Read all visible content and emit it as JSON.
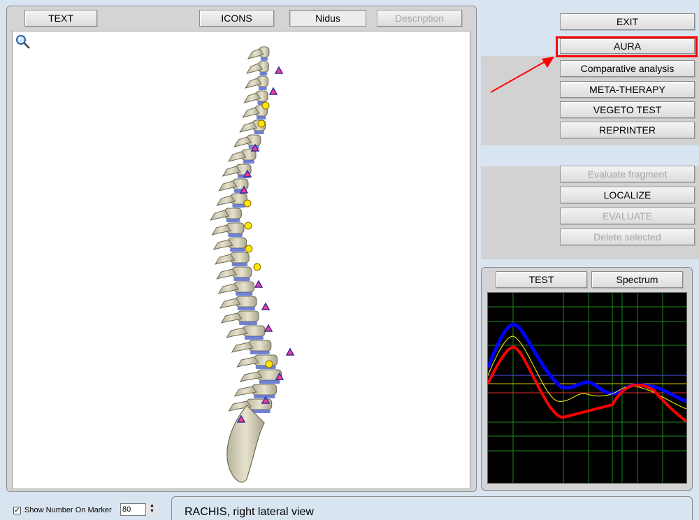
{
  "top_tabs": {
    "text": "TEXT",
    "icons": "ICONS",
    "nidus": "Nidus",
    "description": "Description"
  },
  "right_buttons": {
    "exit": "EXIT",
    "aura": "AURA",
    "comparative": "Comparative analysis",
    "meta_therapy": "META-THERAPY",
    "vegeto_test": "VEGETO TEST",
    "reprinter": "REPRINTER",
    "evaluate_fragment": "Evaluate fragment",
    "localize": "LOCALIZE",
    "evaluate": "EVALUATE",
    "delete_selected": "Delete selected"
  },
  "graph_tabs": {
    "test": "TEST",
    "spectrum": "Spectrum"
  },
  "bottom": {
    "show_number_label": "Show Number On Marker",
    "show_number_checked": true,
    "marker_size": "80",
    "status_text": "RACHIS, right lateral view"
  },
  "colors": {
    "highlight": "#ff0000",
    "graph_grid": "#1e8a1e",
    "series_blue": "#0000ff",
    "series_red": "#ff0000",
    "series_yellow": "#ffff00"
  },
  "icons": {
    "zoom": "magnifier-icon",
    "marker_triangle": "triangle-marker-icon",
    "marker_hexagon": "hexagon-marker-icon"
  }
}
